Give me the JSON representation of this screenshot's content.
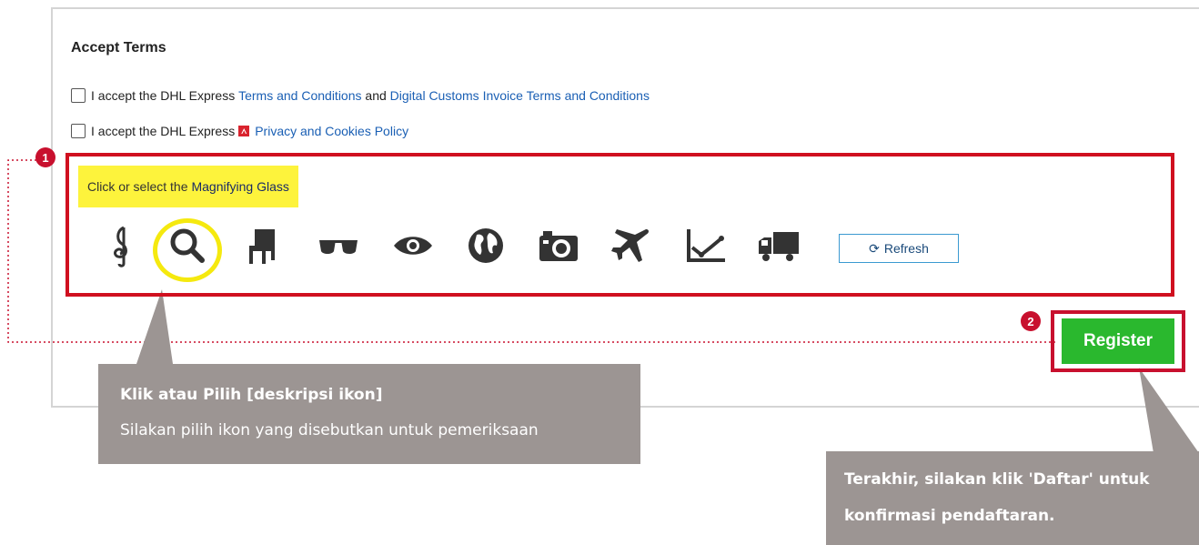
{
  "accept_terms": {
    "title": "Accept Terms",
    "row1": {
      "prefix": "I accept the DHL Express ",
      "link1": "Terms and Conditions",
      "middle": " and ",
      "link2": "Digital Customs Invoice Terms and Conditions"
    },
    "row2": {
      "prefix": "I accept the DHL Express",
      "link": "Privacy and Cookies Policy"
    }
  },
  "captcha": {
    "prompt": "Click or select the",
    "target": "Magnifying Glass",
    "icons": [
      "treble-clef",
      "magnifying-glass",
      "chair",
      "sunglasses",
      "eye",
      "globe",
      "camera",
      "airplane",
      "line-chart",
      "truck"
    ],
    "refresh_label": "Refresh"
  },
  "register": {
    "label": "Register"
  },
  "badges": {
    "one": "1",
    "two": "2"
  },
  "callouts": {
    "icon_title": "Klik atau Pilih [deskripsi ikon]",
    "icon_body": "Silakan pilih ikon yang disebutkan untuk pemeriksaan",
    "register_line1": "Terakhir, silakan klik 'Daftar' untuk",
    "register_line2": "konfirmasi pendaftaran."
  },
  "colors": {
    "highlight_red": "#c8102e",
    "highlight_yellow": "#fdf33c",
    "register_green": "#2ab82e",
    "callout_gray": "#9c9593",
    "link_blue": "#1a5fb4"
  }
}
